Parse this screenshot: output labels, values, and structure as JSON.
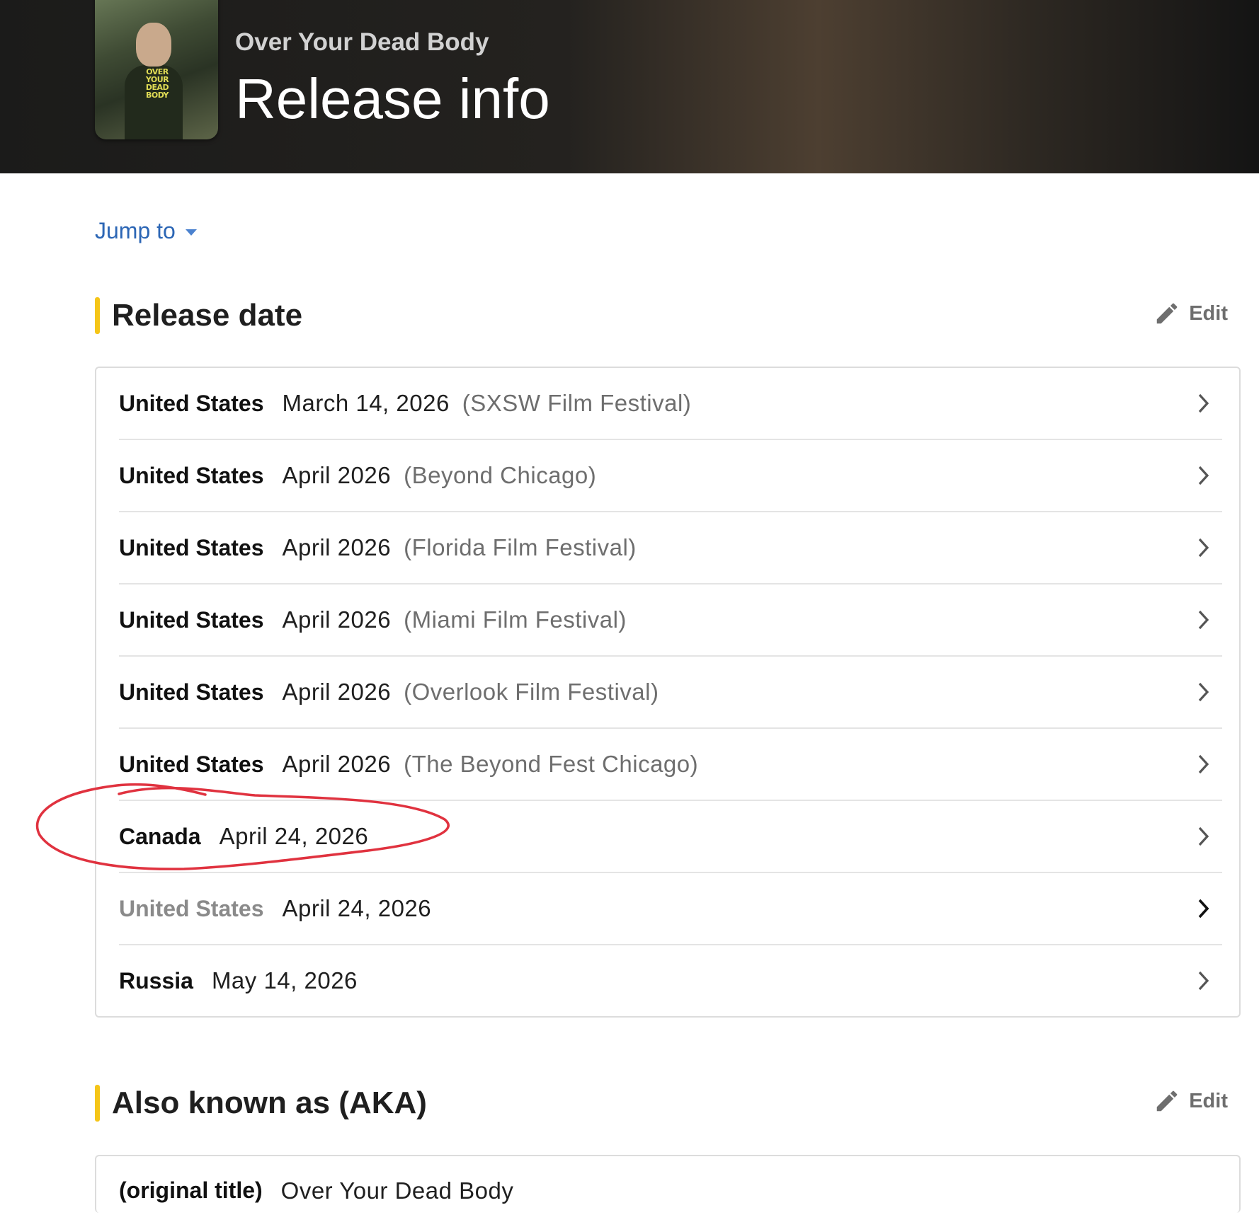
{
  "header": {
    "movie_title": "Over Your Dead Body",
    "page_title": "Release info",
    "poster_title": "OVER YOUR DEAD BODY"
  },
  "nav": {
    "jump_to_label": "Jump to"
  },
  "release_date_section": {
    "heading": "Release date",
    "edit_label": "Edit",
    "rows": [
      {
        "country": "United States",
        "date": "March 14, 2026",
        "attribute": "(SXSW Film Festival)"
      },
      {
        "country": "United States",
        "date": "April 2026",
        "attribute": "(Beyond Chicago)"
      },
      {
        "country": "United States",
        "date": "April 2026",
        "attribute": "(Florida Film Festival)"
      },
      {
        "country": "United States",
        "date": "April 2026",
        "attribute": "(Miami Film Festival)"
      },
      {
        "country": "United States",
        "date": "April 2026",
        "attribute": "(Overlook Film Festival)"
      },
      {
        "country": "United States",
        "date": "April 2026",
        "attribute": "(The Beyond Fest Chicago)"
      },
      {
        "country": "Canada",
        "date": "April 24, 2026",
        "attribute": ""
      },
      {
        "country": "United States",
        "date": "April 24, 2026",
        "attribute": ""
      },
      {
        "country": "Russia",
        "date": "May 14, 2026",
        "attribute": ""
      }
    ]
  },
  "aka_section": {
    "heading": "Also known as (AKA)",
    "edit_label": "Edit",
    "rows": [
      {
        "label": "(original title)",
        "value": "Over Your Dead Body"
      }
    ]
  },
  "colors": {
    "accent_bar": "#f5c518",
    "link": "#2c66b5",
    "annotation": "#e0323f"
  }
}
